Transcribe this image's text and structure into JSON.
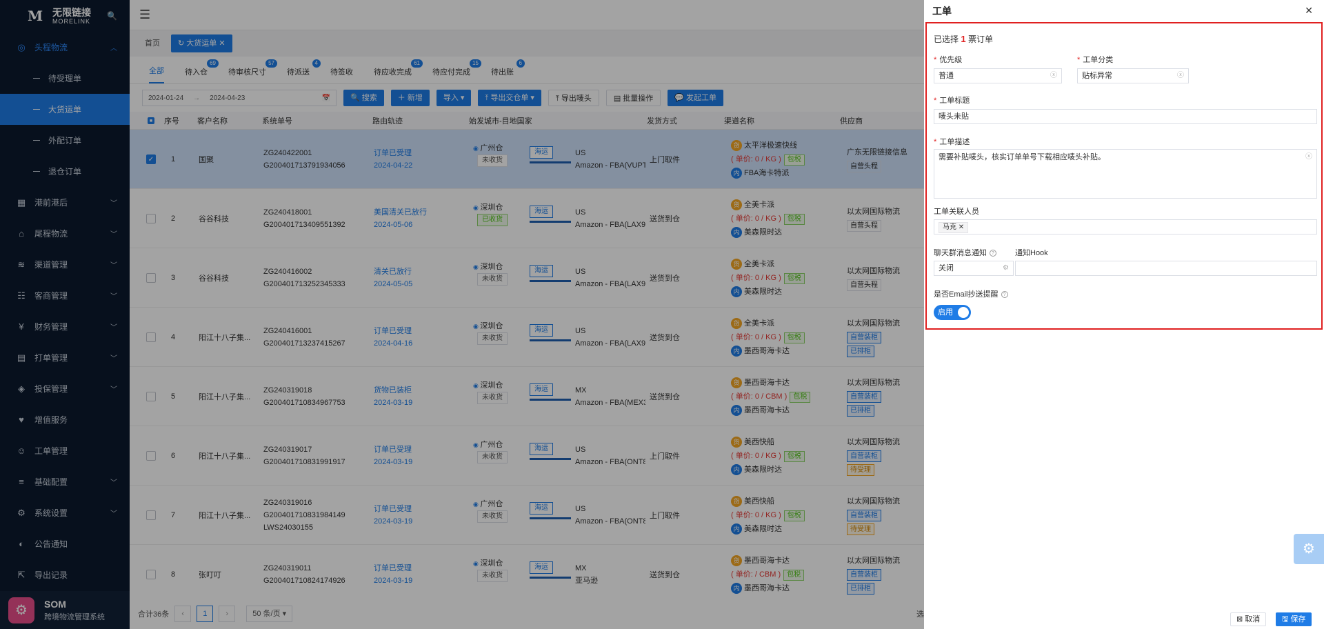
{
  "brand": {
    "logo_mark": "M",
    "name_cn": "无限链接",
    "name_en": "MORELINK"
  },
  "sidebar": {
    "items": [
      {
        "label": "头程物流",
        "icon": "globe-icon",
        "open": true
      },
      {
        "label": "港前港后",
        "icon": "grid-icon"
      },
      {
        "label": "尾程物流",
        "icon": "home-icon"
      },
      {
        "label": "渠道管理",
        "icon": "route-icon"
      },
      {
        "label": "客商管理",
        "icon": "people-icon"
      },
      {
        "label": "财务管理",
        "icon": "yen-icon"
      },
      {
        "label": "打单管理",
        "icon": "print-icon"
      },
      {
        "label": "投保管理",
        "icon": "shield-icon"
      },
      {
        "label": "增值服务",
        "icon": "heart-icon"
      },
      {
        "label": "工单管理",
        "icon": "user-icon"
      },
      {
        "label": "基础配置",
        "icon": "layers-icon"
      },
      {
        "label": "系统设置",
        "icon": "gear-icon"
      },
      {
        "label": "公告通知",
        "icon": "bell-icon"
      },
      {
        "label": "导出记录",
        "icon": "export-icon"
      }
    ],
    "sub_items": [
      "待受理单",
      "大货运单",
      "外配订单",
      "退仓订单"
    ],
    "active_sub": "大货运单"
  },
  "som": {
    "avatar": "⚙",
    "title": "SOM",
    "subtitle": "跨境物流管理系统"
  },
  "tags": {
    "home": "首页",
    "current": "大货运单"
  },
  "status_tabs": [
    {
      "label": "全部",
      "badge": ""
    },
    {
      "label": "待入仓",
      "badge": "69"
    },
    {
      "label": "待审核尺寸",
      "badge": "57"
    },
    {
      "label": "待派送",
      "badge": "4"
    },
    {
      "label": "待签收",
      "badge": ""
    },
    {
      "label": "待应收完成",
      "badge": "61"
    },
    {
      "label": "待应付完成",
      "badge": "15"
    },
    {
      "label": "待出账",
      "badge": "6"
    }
  ],
  "toolbar": {
    "date_start": "2024-01-24",
    "date_end": "2024-04-23",
    "search": "搜索",
    "add": "新增",
    "import": "导入",
    "export_order": "导出交仓单",
    "export_label": "导出唛头",
    "batch": "批量操作",
    "create_ticket": "发起工单"
  },
  "table": {
    "headers": [
      "序号",
      "客户名称",
      "系统单号",
      "路由轨迹",
      "始发城市-目地国家",
      "发货方式",
      "渠道名称",
      "供应商"
    ],
    "rows": [
      {
        "idx": "1",
        "customer": "国聚",
        "sys1": "ZG240422001",
        "sys2": "G200401713791934056",
        "route": "订单已受理",
        "date": "2024-04-22",
        "city": "广州仓",
        "city_status": "未收货",
        "ship": "海运",
        "country": "US",
        "dest": "Amazon - FBA(VUPT)",
        "method": "上门取件",
        "ch_name": "太平洋极速快线",
        "unit": "0",
        "unit_u": "KG",
        "tax": "包税",
        "ch2": "FBA海卡特派",
        "supplier": "广东无限链接信息",
        "sup_tags": [
          {
            "t": "自营头程",
            "c": ""
          }
        ],
        "sel": true
      },
      {
        "idx": "2",
        "customer": "谷谷科技",
        "sys1": "ZG240418001",
        "sys2": "G200401713409551392",
        "route": "美国清关已放行",
        "date": "2024-05-06",
        "city": "深圳仓",
        "city_status": "已收货",
        "ship": "海运",
        "country": "US",
        "dest": "Amazon - FBA(LAX9)",
        "method": "送货到仓",
        "ch_name": "全美卡派",
        "unit": "0",
        "unit_u": "KG",
        "tax": "包税",
        "ch2": "美森限时达",
        "supplier": "以太网国际物流",
        "sup_tags": [
          {
            "t": "自营头程",
            "c": ""
          }
        ],
        "sel": false
      },
      {
        "idx": "3",
        "customer": "谷谷科技",
        "sys1": "ZG240416002",
        "sys2": "G200401713252345333",
        "route": "清关已放行",
        "date": "2024-05-05",
        "city": "深圳仓",
        "city_status": "未收货",
        "ship": "海运",
        "country": "US",
        "dest": "Amazon - FBA(LAX9)",
        "method": "送货到仓",
        "ch_name": "全美卡派",
        "unit": "0",
        "unit_u": "KG",
        "tax": "包税",
        "ch2": "美森限时达",
        "supplier": "以太网国际物流",
        "sup_tags": [
          {
            "t": "自营头程",
            "c": ""
          }
        ],
        "sel": false
      },
      {
        "idx": "4",
        "customer": "阳江十八子集...",
        "sys1": "ZG240416001",
        "sys2": "G200401713237415267",
        "route": "订单已受理",
        "date": "2024-04-16",
        "city": "深圳仓",
        "city_status": "未收货",
        "ship": "海运",
        "country": "US",
        "dest": "Amazon - FBA(LAX9)",
        "method": "送货到仓",
        "ch_name": "全美卡派",
        "unit": "0",
        "unit_u": "KG",
        "tax": "包税",
        "ch2": "墨西哥海卡达",
        "supplier": "以太网国际物流",
        "sup_tags": [
          {
            "t": "自营装柜",
            "c": "blue"
          },
          {
            "t": "已排柜",
            "c": "blue"
          }
        ],
        "sel": false
      },
      {
        "idx": "5",
        "customer": "阳江十八子集...",
        "sys1": "ZG240319018",
        "sys2": "G200401710834967753",
        "route": "货物已装柜",
        "date": "2024-03-19",
        "city": "深圳仓",
        "city_status": "未收货",
        "ship": "海运",
        "country": "MX",
        "dest": "Amazon - FBA(MEX3)",
        "method": "送货到仓",
        "ch_name": "墨西哥海卡达",
        "unit": "0",
        "unit_u": "CBM",
        "tax": "包税",
        "ch2": "墨西哥海卡达",
        "supplier": "以太网国际物流",
        "sup_tags": [
          {
            "t": "自营装柜",
            "c": "blue"
          },
          {
            "t": "已排柜",
            "c": "blue"
          }
        ],
        "sel": false
      },
      {
        "idx": "6",
        "customer": "阳江十八子集...",
        "sys1": "ZG240319017",
        "sys2": "G200401710831991917",
        "route": "订单已受理",
        "date": "2024-03-19",
        "city": "广州仓",
        "city_status": "未收货",
        "ship": "海运",
        "country": "US",
        "dest": "Amazon - FBA(ONT8)",
        "method": "上门取件",
        "ch_name": "美西快船",
        "unit": "0",
        "unit_u": "KG",
        "tax": "包税",
        "ch2": "美森限时达",
        "supplier": "以太网国际物流",
        "sup_tags": [
          {
            "t": "自营装柜",
            "c": "blue"
          },
          {
            "t": "待受理",
            "c": "orange"
          }
        ],
        "sel": false
      },
      {
        "idx": "7",
        "customer": "阳江十八子集...",
        "sys1": "ZG240319016",
        "sys2": "G200401710831984149",
        "sys3": "LWS24030155",
        "route": "订单已受理",
        "date": "2024-03-19",
        "city": "广州仓",
        "city_status": "未收货",
        "ship": "海运",
        "country": "US",
        "dest": "Amazon - FBA(ONT8)",
        "method": "上门取件",
        "ch_name": "美西快船",
        "unit": "0",
        "unit_u": "KG",
        "tax": "包税",
        "ch2": "美森限时达",
        "supplier": "以太网国际物流",
        "sup_tags": [
          {
            "t": "自营装柜",
            "c": "blue"
          },
          {
            "t": "待受理",
            "c": "orange"
          }
        ],
        "sel": false
      },
      {
        "idx": "8",
        "customer": "张叮叮",
        "sys1": "ZG240319011",
        "sys2": "G200401710824174926",
        "route": "订单已受理",
        "date": "2024-03-19",
        "city": "深圳仓",
        "city_status": "未收货",
        "ship": "海运",
        "country": "MX",
        "dest": "亚马逊",
        "method": "送货到仓",
        "ch_name": "墨西哥海卡达",
        "unit": "",
        "unit_u": "CBM",
        "tax": "包税",
        "ch2": "墨西哥海卡达",
        "supplier": "以太网国际物流",
        "sup_tags": [
          {
            "t": "自营装柜",
            "c": "blue"
          },
          {
            "t": "已排柜",
            "c": "blue"
          }
        ],
        "sel": false
      }
    ]
  },
  "pager": {
    "total": "合计36条",
    "page": "1",
    "size": "50 条/页",
    "right": "选"
  },
  "drawer": {
    "title": "工单",
    "selected_prefix": "已选择",
    "selected_count": "1",
    "selected_suffix": "票订单",
    "priority_label": "优先级",
    "priority_value": "普通",
    "category_label": "工单分类",
    "category_value": "贴标异常",
    "title_label": "工单标题",
    "title_value": "唛头未贴",
    "desc_label": "工单描述",
    "desc_value": "需要补贴唛头，核实订单单号下载相应唛头补贴。",
    "person_label": "工单关联人员",
    "person_value": "马克",
    "chat_label": "聊天群消息通知",
    "chat_value": "关闭",
    "hook_label": "通知Hook",
    "email_label": "是否Email抄送提醒",
    "email_toggle": "启用",
    "cancel": "取消",
    "save": "保存"
  }
}
